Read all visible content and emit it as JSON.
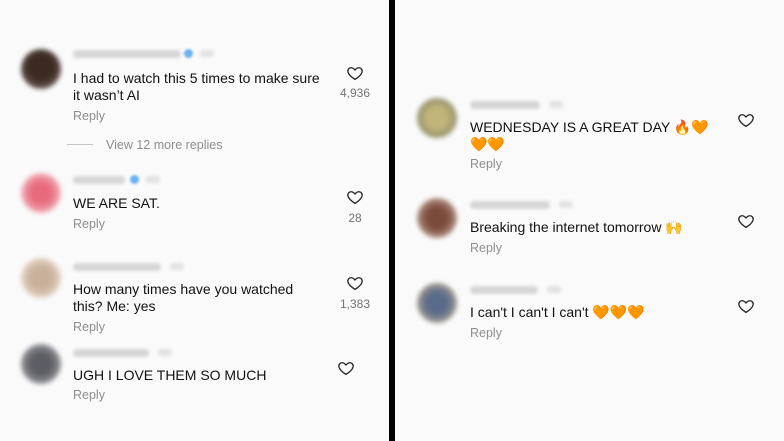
{
  "left_comments": [
    {
      "text": "I had to watch this 5 times to make sure it wasn’t AI",
      "reply": "Reply",
      "likes": "4,936",
      "view_more": "View 12 more replies"
    },
    {
      "text": "WE ARE SAT.",
      "reply": "Reply",
      "likes": "28"
    },
    {
      "text": "How many times have you watched this? Me: yes",
      "reply": "Reply",
      "likes": "1,383"
    },
    {
      "text": "UGH I LOVE THEM SO MUCH",
      "reply": "Reply"
    }
  ],
  "right_comments": [
    {
      "text": "WEDNESDAY IS A GREAT DAY",
      "emoji_line1": "🔥🧡",
      "emoji_line2": "🧡🧡",
      "reply": "Reply"
    },
    {
      "text": "Breaking the internet tomorrow",
      "emoji": "🙌",
      "reply": "Reply"
    },
    {
      "text": "I can't I can't I can't",
      "emoji": "🧡🧡🧡",
      "reply": "Reply"
    }
  ],
  "colors": {
    "reply_gray": "#8e8e8e",
    "text": "#111111",
    "divider": "#000000"
  },
  "icons": {
    "like": "heart-outline-icon"
  }
}
